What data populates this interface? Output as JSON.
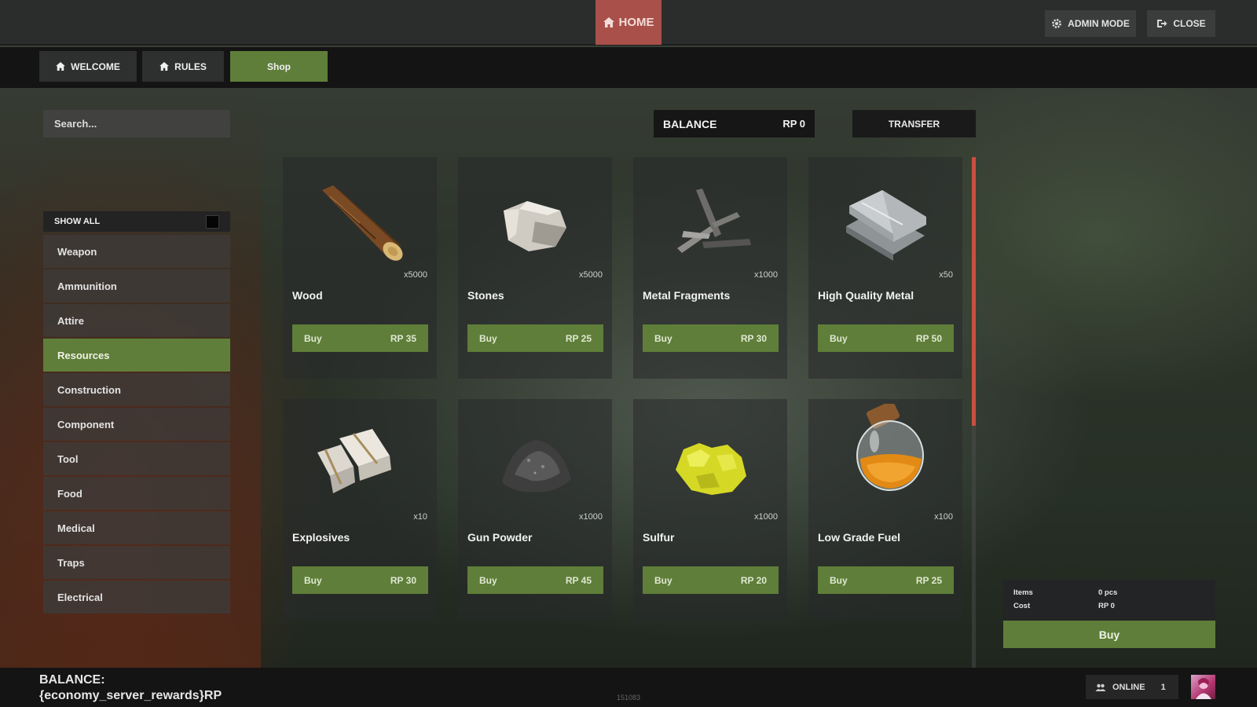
{
  "header": {
    "home_label": "HOME",
    "admin_label": "ADMIN MODE",
    "close_label": "CLOSE"
  },
  "nav": {
    "tabs": [
      {
        "label": "WELCOME",
        "icon": "home-icon"
      },
      {
        "label": "RULES",
        "icon": "home-icon"
      },
      {
        "label": "Shop",
        "active": true
      }
    ]
  },
  "sidebar": {
    "search_placeholder": "Search...",
    "show_all_label": "SHOW ALL",
    "categories": [
      "Weapon",
      "Ammunition",
      "Attire",
      "Resources",
      "Construction",
      "Component",
      "Tool",
      "Food",
      "Medical",
      "Traps",
      "Electrical"
    ],
    "active_category": "Resources"
  },
  "balance": {
    "label": "BALANCE",
    "value": "RP 0",
    "transfer_label": "TRANSFER"
  },
  "products": [
    {
      "name": "Wood",
      "qty": "x5000",
      "buy_label": "Buy",
      "price": "RP 35",
      "icon": "wood-log-icon"
    },
    {
      "name": "Stones",
      "qty": "x5000",
      "buy_label": "Buy",
      "price": "RP 25",
      "icon": "stones-icon"
    },
    {
      "name": "Metal Fragments",
      "qty": "x1000",
      "buy_label": "Buy",
      "price": "RP 30",
      "icon": "metal-fragments-icon"
    },
    {
      "name": "High Quality Metal",
      "qty": "x50",
      "buy_label": "Buy",
      "price": "RP 50",
      "icon": "hq-metal-icon"
    },
    {
      "name": "Explosives",
      "qty": "x10",
      "buy_label": "Buy",
      "price": "RP 30",
      "icon": "explosives-icon"
    },
    {
      "name": "Gun Powder",
      "qty": "x1000",
      "buy_label": "Buy",
      "price": "RP 45",
      "icon": "gun-powder-icon"
    },
    {
      "name": "Sulfur",
      "qty": "x1000",
      "buy_label": "Buy",
      "price": "RP 20",
      "icon": "sulfur-icon"
    },
    {
      "name": "Low Grade Fuel",
      "qty": "x100",
      "buy_label": "Buy",
      "price": "RP 25",
      "icon": "fuel-jar-icon"
    }
  ],
  "cart": {
    "items_label": "Items",
    "items_value": "0 pcs",
    "cost_label": "Cost",
    "cost_value": "RP 0",
    "buy_label": "Buy"
  },
  "footer": {
    "balance_line1": "BALANCE:",
    "balance_line2": "{economy_server_rewards}RP",
    "build_id": "151083",
    "online_label": "ONLINE",
    "online_count": "1"
  },
  "colors": {
    "accent_green": "#5f7e39",
    "home_red": "#a9504a",
    "scroll_red": "#c85040",
    "dark": "#141414"
  }
}
